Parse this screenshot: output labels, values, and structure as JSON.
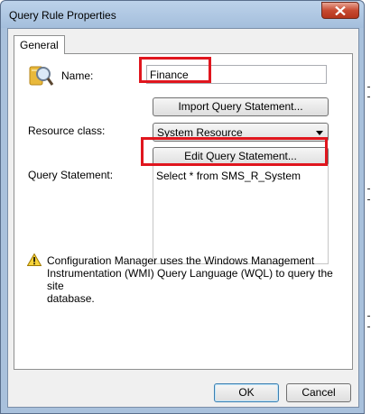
{
  "window": {
    "title": "Query Rule Properties"
  },
  "tabs": [
    {
      "label": "General"
    }
  ],
  "name_field": {
    "label": "Name:",
    "value": "Finance"
  },
  "import_button": {
    "label": "Import Query Statement..."
  },
  "resource_class": {
    "label": "Resource class:",
    "selected": "System Resource"
  },
  "edit_button": {
    "label": "Edit Query Statement..."
  },
  "query_statement": {
    "label": "Query Statement:",
    "value": "Select * from SMS_R_System"
  },
  "info": {
    "line1": "Configuration Manager uses the Windows Management",
    "line2": "Instrumentation (WMI) Query Language (WQL) to query the site",
    "line3": "database."
  },
  "footer": {
    "ok_label": "OK",
    "cancel_label": "Cancel"
  },
  "colors": {
    "highlight": "#e0161e",
    "title_bar": "#a4bedc",
    "close_button": "#c74a31"
  },
  "icons": [
    "query-magnifier-icon",
    "close-icon",
    "dropdown-arrow-icon",
    "warning-icon"
  ]
}
